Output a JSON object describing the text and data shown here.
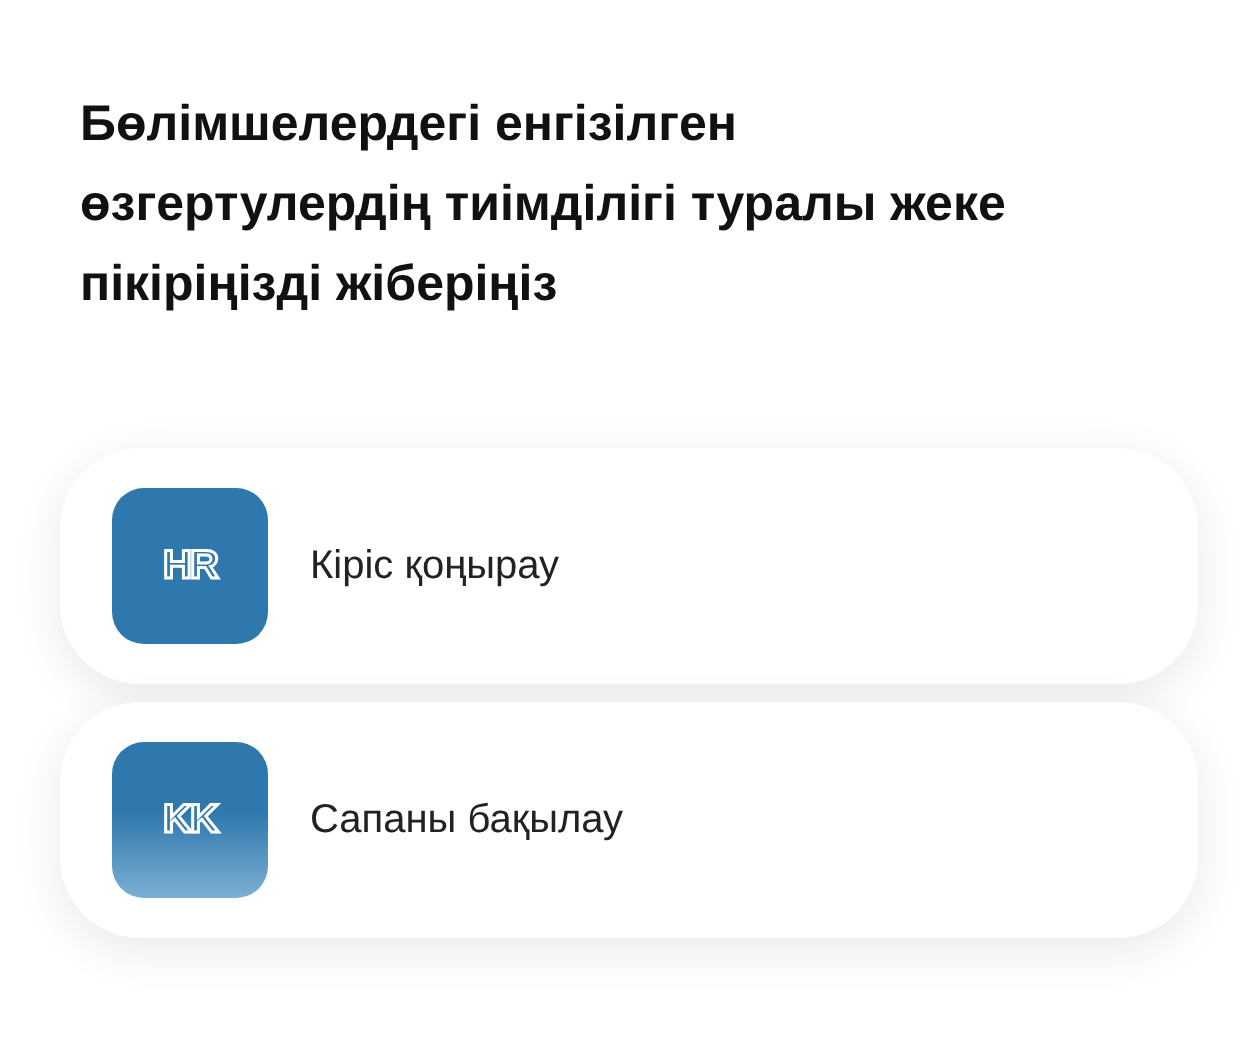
{
  "title": "Бөлімшелердегі енгізілген өзгертулердің тиімділігі туралы жеке пікіріңізді жіберіңіз",
  "options": [
    {
      "badge": "HR",
      "label": "Кіріс қоңырау",
      "kind": "solid"
    },
    {
      "badge": "KK",
      "label": "Сапаны бақылау",
      "kind": "fade"
    }
  ]
}
